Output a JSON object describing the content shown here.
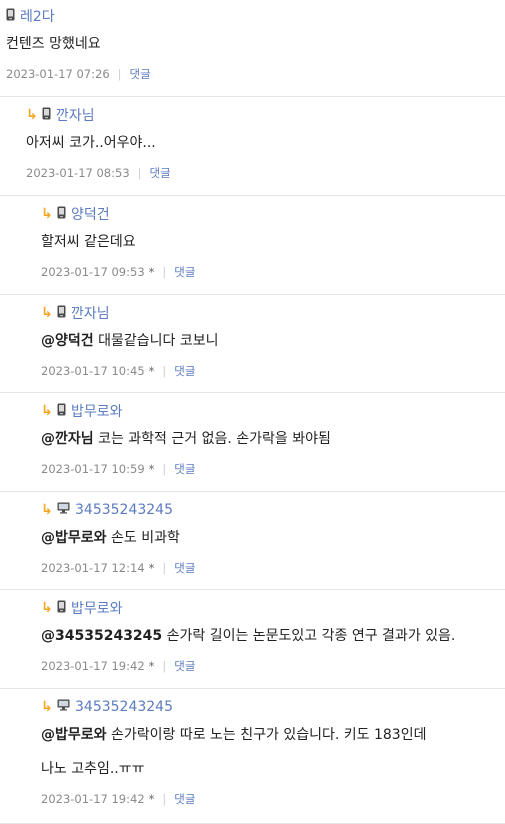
{
  "comments": [
    {
      "nick": "레2다",
      "device": "phone",
      "is_reply": false,
      "mention": "",
      "text": "컨텐즈 망했네요",
      "text2": "",
      "date": "2023-01-17 07:26",
      "star": "",
      "reply": "댓글"
    },
    {
      "nick": "깐자님",
      "device": "phone",
      "is_reply": true,
      "mention": "",
      "text": "아저씨 코가..어우야...",
      "text2": "",
      "date": "2023-01-17 08:53",
      "star": "",
      "reply": "댓글"
    },
    {
      "nick": "양덕건",
      "device": "phone",
      "is_reply": true,
      "mention": "",
      "text": "할저씨 같은데요",
      "text2": "",
      "date": "2023-01-17 09:53",
      "star": "*",
      "reply": "댓글"
    },
    {
      "nick": "깐자님",
      "device": "phone",
      "is_reply": true,
      "mention": "@양덕건",
      "text": " 대물같습니다 코보니",
      "text2": "",
      "date": "2023-01-17 10:45",
      "star": "*",
      "reply": "댓글"
    },
    {
      "nick": "밥무로와",
      "device": "phone",
      "is_reply": true,
      "mention": "@깐자님",
      "text": " 코는 과학적 근거 없음. 손가락을 봐야됨",
      "text2": "",
      "date": "2023-01-17 10:59",
      "star": "*",
      "reply": "댓글"
    },
    {
      "nick": "34535243245",
      "device": "pc",
      "is_reply": true,
      "mention": "@밥무로와",
      "text": " 손도 비과학",
      "text2": "",
      "date": "2023-01-17 12:14",
      "star": "*",
      "reply": "댓글"
    },
    {
      "nick": "밥무로와",
      "device": "phone",
      "is_reply": true,
      "mention": "@34535243245",
      "text": " 손가락 길이는 논문도있고 각종 연구 결과가 있음.",
      "text2": "",
      "date": "2023-01-17 19:42",
      "star": "*",
      "reply": "댓글"
    },
    {
      "nick": "34535243245",
      "device": "pc",
      "is_reply": true,
      "mention": "@밥무로와",
      "text": " 손가락이랑 따로 노는 친구가 있습니다. 키도 183인데",
      "text2": "나노 고추임..ㅠㅠ",
      "date": "2023-01-17 19:42",
      "star": "*",
      "reply": "댓글"
    }
  ]
}
